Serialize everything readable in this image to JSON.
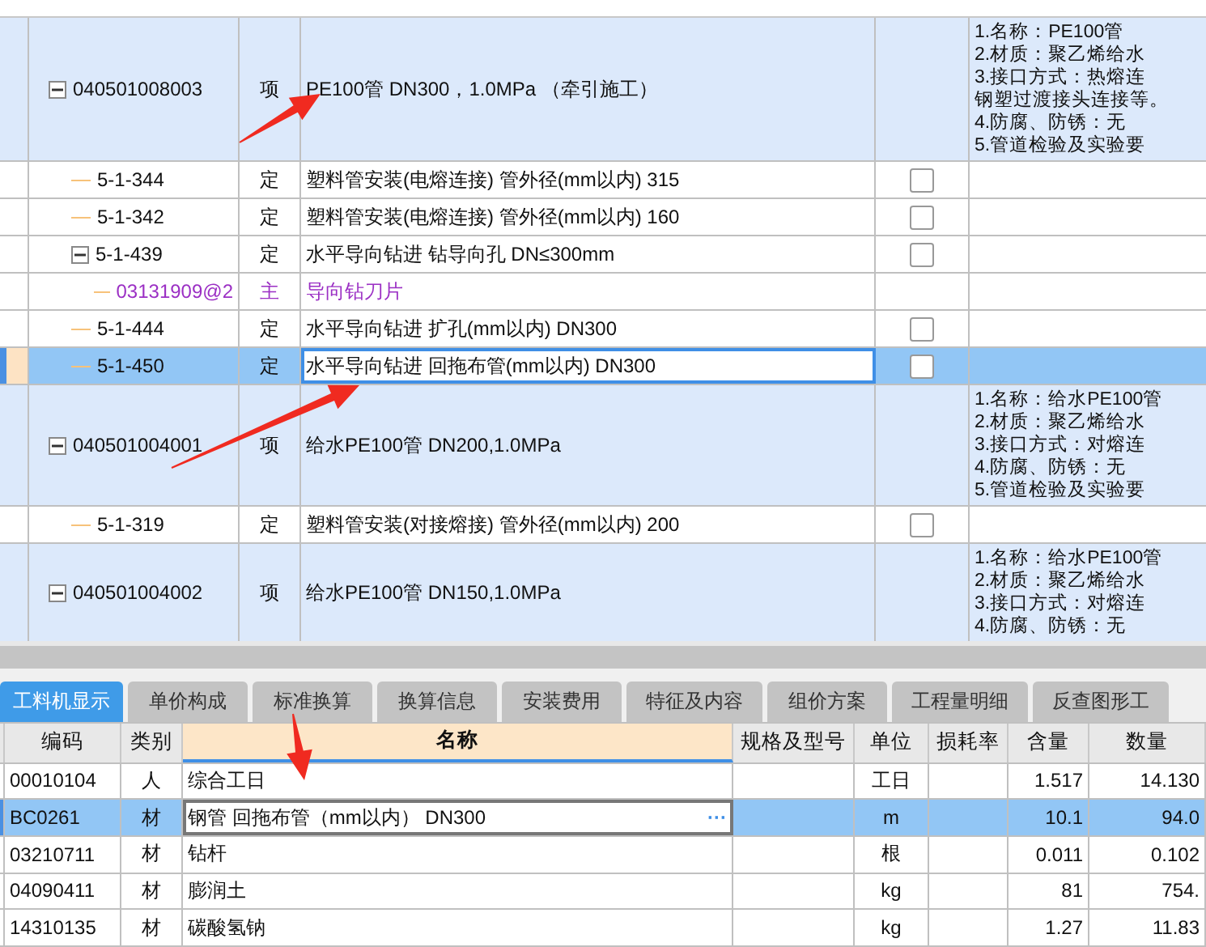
{
  "upper_grid": {
    "rows": [
      {
        "code": "040501008003",
        "type": "项",
        "kind": "item",
        "name": "PE100管 DN300，1.0MPa （牵引施工）",
        "selected": false,
        "expanded": true,
        "features": [
          "1.名称：PE100管",
          "2.材质：聚乙烯给水",
          "3.接口方式：热熔连",
          "钢塑过渡接头连接等。",
          "4.防腐、防锈：无",
          "5.管道检验及实验要"
        ],
        "children": [
          {
            "code": "5-1-344",
            "type": "定",
            "kind": "quota",
            "name": "塑料管安装(电熔连接) 管外径(mm以内) 315",
            "selected": false,
            "checked": false
          },
          {
            "code": "5-1-342",
            "type": "定",
            "kind": "quota",
            "name": "塑料管安装(电熔连接) 管外径(mm以内) 160",
            "selected": false,
            "checked": false
          },
          {
            "code": "5-1-439",
            "type": "定",
            "kind": "quota",
            "name": "水平导向钻进 钻导向孔 DN≤300mm",
            "selected": false,
            "checked": false,
            "expanded": true,
            "children": [
              {
                "code": "03131909@2",
                "type": "主",
                "kind": "main",
                "name": "导向钻刀片",
                "selected": false
              }
            ]
          },
          {
            "code": "5-1-444",
            "type": "定",
            "kind": "quota",
            "name": "水平导向钻进 扩孔(mm以内) DN300",
            "selected": false,
            "checked": false
          },
          {
            "code": "5-1-450",
            "type": "定",
            "kind": "quota",
            "name": "水平导向钻进 回拖布管(mm以内) DN300",
            "selected": true,
            "checked": false
          }
        ]
      },
      {
        "code": "040501004001",
        "type": "项",
        "kind": "item",
        "name": "给水PE100管 DN200,1.0MPa",
        "selected": false,
        "expanded": true,
        "features": [
          "1.名称：给水PE100管",
          "2.材质：聚乙烯给水",
          "3.接口方式：对熔连",
          "4.防腐、防锈：无",
          "5.管道检验及实验要"
        ],
        "children": [
          {
            "code": "5-1-319",
            "type": "定",
            "kind": "quota",
            "name": "塑料管安装(对接熔接) 管外径(mm以内) 200",
            "selected": false,
            "checked": false
          }
        ]
      },
      {
        "code": "040501004002",
        "type": "项",
        "kind": "item",
        "name": "给水PE100管 DN150,1.0MPa",
        "selected": false,
        "expanded": true,
        "features": [
          "1.名称：给水PE100管",
          "2.材质：聚乙烯给水",
          "3.接口方式：对熔连",
          "4.防腐、防锈：无"
        ]
      }
    ]
  },
  "tabs": [
    {
      "label": "工料机显示",
      "selected": true
    },
    {
      "label": "单价构成",
      "selected": false
    },
    {
      "label": "标准换算",
      "selected": false
    },
    {
      "label": "换算信息",
      "selected": false
    },
    {
      "label": "安装费用",
      "selected": false
    },
    {
      "label": "特征及内容",
      "selected": false
    },
    {
      "label": "组价方案",
      "selected": false
    },
    {
      "label": "工程量明细",
      "selected": false
    },
    {
      "label": "反查图形工",
      "selected": false
    }
  ],
  "lower_grid": {
    "columns": [
      "编码",
      "类别",
      "名称",
      "规格及型号",
      "单位",
      "损耗率",
      "含量",
      "数量"
    ],
    "rows": [
      {
        "code": "00010104",
        "type": "人",
        "name": "综合工日",
        "unit": "工日",
        "content": "1.517",
        "quantity": "14.130",
        "selected": false
      },
      {
        "code": "BC0261",
        "type": "材",
        "name": "钢管 回拖布管（mm以内） DN300",
        "unit": "m",
        "content": "10.1",
        "quantity": "94.0",
        "selected": true,
        "edit_button": "···"
      },
      {
        "code": "03210711",
        "type": "材",
        "name": "钻杆",
        "unit": "根",
        "content": "0.011",
        "quantity": "0.102",
        "selected": false
      },
      {
        "code": "04090411",
        "type": "材",
        "name": "膨润土",
        "unit": "kg",
        "content": "81",
        "quantity": "754.",
        "selected": false
      },
      {
        "code": "14310135",
        "type": "材",
        "name": "碳酸氢钠",
        "unit": "kg",
        "content": "1.27",
        "quantity": "11.83",
        "selected": false
      }
    ]
  }
}
